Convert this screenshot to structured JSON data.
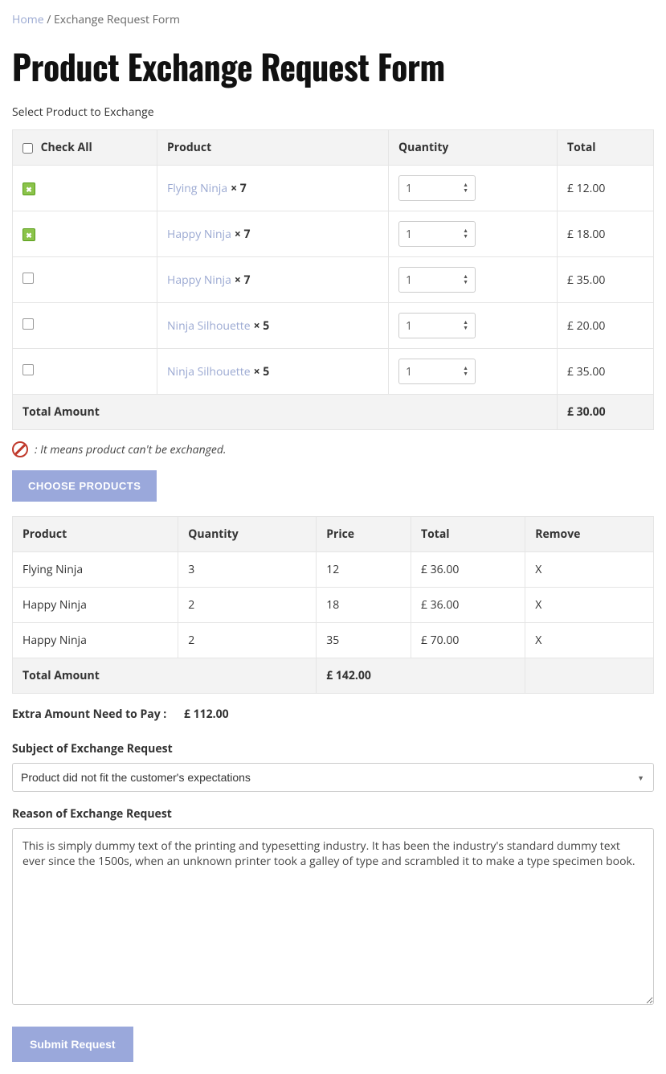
{
  "breadcrumb": {
    "home": "Home",
    "sep": "/",
    "current": "Exchange Request Form"
  },
  "page_title": "Product Exchange Request Form",
  "select_label": "Select Product to Exchange",
  "table1": {
    "headers": {
      "checkall": "Check All",
      "product": "Product",
      "quantity": "Quantity",
      "total": "Total"
    },
    "rows": [
      {
        "disabled": true,
        "product": "Flying Ninja",
        "mult": "× 7",
        "qty": "1",
        "total": "£ 12.00"
      },
      {
        "disabled": true,
        "product": "Happy Ninja",
        "mult": "× 7",
        "qty": "1",
        "total": "£ 18.00"
      },
      {
        "disabled": false,
        "product": "Happy Ninja",
        "mult": "× 7",
        "qty": "1",
        "total": "£ 35.00"
      },
      {
        "disabled": false,
        "product": "Ninja Silhouette",
        "mult": "× 5",
        "qty": "1",
        "total": "£ 20.00"
      },
      {
        "disabled": false,
        "product": "Ninja Silhouette",
        "mult": "× 5",
        "qty": "1",
        "total": "£ 35.00"
      }
    ],
    "total_label": "Total Amount",
    "total_value": "£ 30.00"
  },
  "note": ": It means product can't be exchanged.",
  "choose_btn": "CHOOSE PRODUCTS",
  "table2": {
    "headers": {
      "product": "Product",
      "quantity": "Quantity",
      "price": "Price",
      "total": "Total",
      "remove": "Remove"
    },
    "rows": [
      {
        "product": "Flying Ninja",
        "qty": "3",
        "price": "12",
        "total": "£ 36.00",
        "remove": "X"
      },
      {
        "product": "Happy Ninja",
        "qty": "2",
        "price": "18",
        "total": "£ 36.00",
        "remove": "X"
      },
      {
        "product": "Happy Ninja",
        "qty": "2",
        "price": "35",
        "total": "£ 70.00",
        "remove": "X"
      }
    ],
    "total_label": "Total Amount",
    "total_value": "£ 142.00"
  },
  "extra": {
    "label": "Extra Amount Need to Pay :",
    "value": "£ 112.00"
  },
  "subject": {
    "label": "Subject of Exchange Request",
    "value": "Product did not fit the customer's expectations"
  },
  "reason": {
    "label": "Reason of Exchange Request",
    "value": "This is simply dummy text of the printing and typesetting industry. It has been the industry's standard dummy text ever since the 1500s, when an unknown printer took a galley of type and scrambled it to make a type specimen book."
  },
  "submit": "Submit Request"
}
